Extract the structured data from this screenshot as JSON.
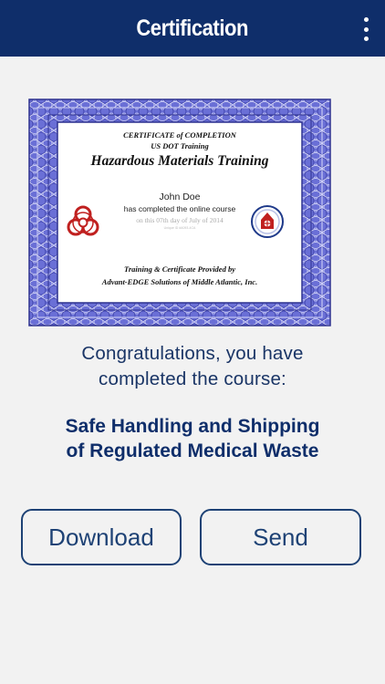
{
  "header": {
    "title": "Certification",
    "menu_icon": "more-vertical-icon"
  },
  "certificate": {
    "line1": "CERTIFICATE of COMPLETION",
    "line2": "US DOT Training",
    "title": "Hazardous Materials Training",
    "name": "John Doe",
    "completed_text": "has completed the online course",
    "date_text": "on this 07th day of  July of 2014",
    "id_text": "Unique ID #A093-4CA",
    "provided_by": "Training & Certificate Provided by",
    "company": "Advant-EDGE Solutions of Middle Atlantic, Inc.",
    "border_color": "#5a5fc4",
    "left_icon": "biohazard-icon",
    "right_icon": "seal-icon"
  },
  "congrats": {
    "line1": "Congratulations, you have",
    "line2": "completed the course:"
  },
  "course": {
    "line1": "Safe Handling and Shipping",
    "line2": "of Regulated Medical Waste"
  },
  "buttons": {
    "download": "Download",
    "send": "Send"
  },
  "colors": {
    "header_bg": "#0f2e6a",
    "accent": "#1e4275",
    "background": "#f2f2f2"
  }
}
